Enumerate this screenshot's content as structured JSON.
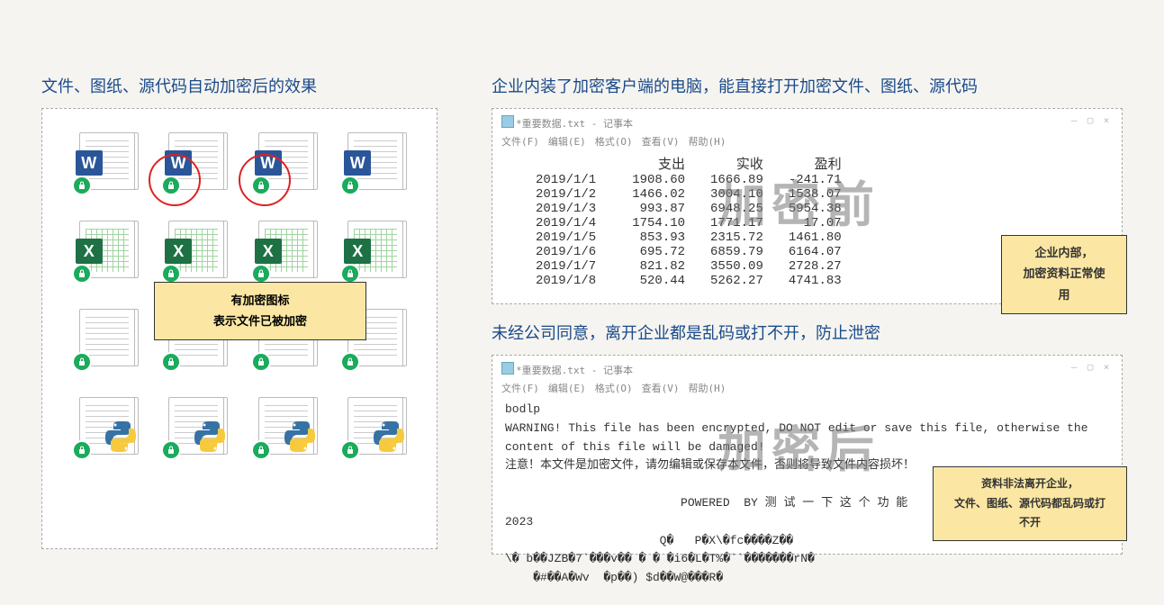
{
  "left": {
    "title": "文件、图纸、源代码自动加密后的效果",
    "rows": [
      {
        "type": "word",
        "count": 4,
        "circles": [
          1,
          2
        ]
      },
      {
        "type": "excel",
        "count": 4
      },
      {
        "type": "plain",
        "count": 4
      },
      {
        "type": "python",
        "count": 4
      }
    ],
    "callout_line1": "有加密图标",
    "callout_line2": "表示文件已被加密"
  },
  "right_top": {
    "title": "企业内装了加密客户端的电脑，能直接打开加密文件、图纸、源代码",
    "np_title": "*重要数据.txt - 记事本",
    "np_menu": [
      "文件(F)",
      "编辑(E)",
      "格式(O)",
      "查看(V)",
      "帮助(H)"
    ],
    "headers": [
      "",
      "支出",
      "实收",
      "盈利"
    ],
    "rows": [
      [
        "2019/1/1",
        "1908.60",
        "1666.89",
        "-241.71"
      ],
      [
        "2019/1/2",
        "1466.02",
        "3004.10",
        "1538.07"
      ],
      [
        "2019/1/3",
        "993.87",
        "6948.25",
        "5954.38"
      ],
      [
        "2019/1/4",
        "1754.10",
        "1771.17",
        "17.07"
      ],
      [
        "2019/1/5",
        "853.93",
        "2315.72",
        "1461.80"
      ],
      [
        "2019/1/6",
        "695.72",
        "6859.79",
        "6164.07"
      ],
      [
        "2019/1/7",
        "821.82",
        "3550.09",
        "2728.27"
      ],
      [
        "2019/1/8",
        "520.44",
        "5262.27",
        "4741.83"
      ]
    ],
    "watermark": "加密前",
    "callout_line1": "企业内部，",
    "callout_line2": "加密资料正常使用"
  },
  "right_bot": {
    "title": "未经公司同意，离开企业都是乱码或打不开，防止泄密",
    "np_title": "*重要数据.txt - 记事本",
    "np_menu": [
      "文件(F)",
      "编辑(E)",
      "格式(O)",
      "查看(V)",
      "帮助(H)"
    ],
    "body_lines": [
      "bodlp",
      "WARNING! This file has been encrypted, DO NOT edit or save this file, otherwise the",
      "content of this file will be damaged!",
      "注意！本文件是加密文件，请勿编辑或保存本文件，否则将导致文件内容损坏！",
      "",
      "                         POWERED  BY 测 试 一 下 这 个 功 能",
      "2023",
      "                      Q�   P�X\\�fc����Z��",
      "\\� b��JZB�7`���v�� � � �i6�L�T%�``�������rN�",
      "    �#��A�Wv  �p��) $d��W@���R�"
    ],
    "watermark": "加密后",
    "callout_line1": "资料非法离开企业，",
    "callout_line2": "文件、图纸、源代码都乱码或打不开"
  },
  "icons": {
    "word": "W",
    "excel": "X",
    "python": "py"
  }
}
